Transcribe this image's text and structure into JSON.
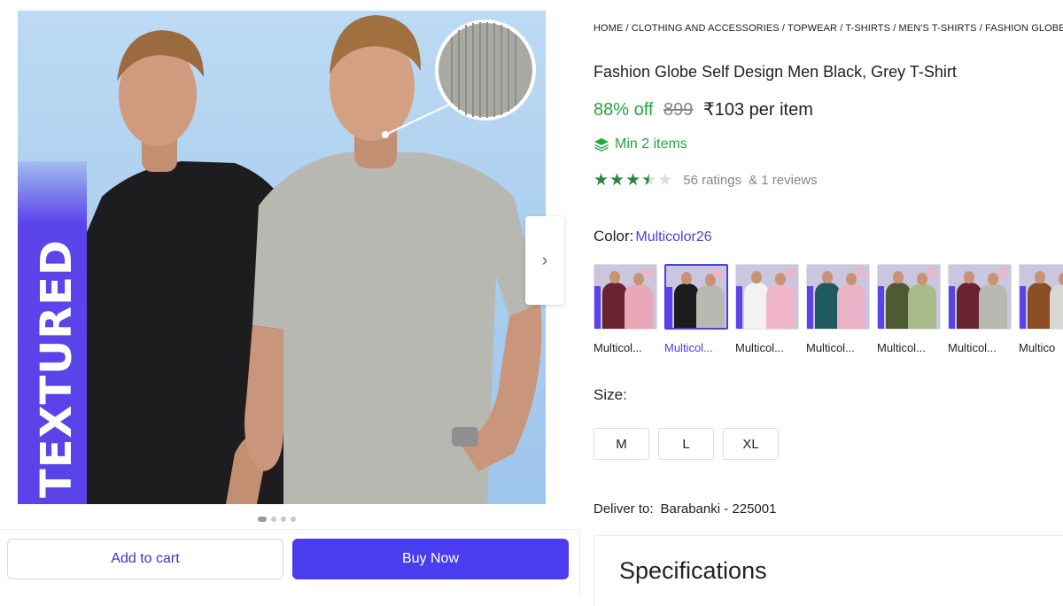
{
  "gallery": {
    "overlay_text": "TEXTURED",
    "next_icon": "chevron-right-icon",
    "next_glyph": "›",
    "dots": [
      true,
      false,
      false,
      false
    ]
  },
  "actions": {
    "add_to_cart": "Add to cart",
    "buy_now": "Buy Now"
  },
  "breadcrumb": "HOME / CLOTHING AND ACCESSORIES / TOPWEAR / T-SHIRTS / MEN'S T-SHIRTS / FASHION GLOBE",
  "product": {
    "title": "Fashion Globe Self Design Men Black, Grey T-Shirt",
    "discount": "88% off",
    "mrp": "899",
    "price": "₹103 per item",
    "min_items": "Min 2 items",
    "rating_value": 3.5,
    "ratings": "56 ratings",
    "reviews": "& 1 reviews"
  },
  "color": {
    "label": "Color:",
    "value": "Multicolor26",
    "swatches": [
      {
        "label": "Multicol...",
        "c1": "#6b2330",
        "c2": "#e8a8b8"
      },
      {
        "label": "Multicol...",
        "c1": "#1c1c1c",
        "c2": "#b9b9b3"
      },
      {
        "label": "Multicol...",
        "c1": "#f2f2f0",
        "c2": "#f0b6c8"
      },
      {
        "label": "Multicol...",
        "c1": "#1f5b5e",
        "c2": "#eab4c8"
      },
      {
        "label": "Multicol...",
        "c1": "#4f5a33",
        "c2": "#a8b98a"
      },
      {
        "label": "Multicol...",
        "c1": "#6b2330",
        "c2": "#b9b9b3"
      },
      {
        "label": "Multico",
        "c1": "#8a4e24",
        "c2": "#d8d8d4"
      }
    ],
    "selected_index": 1
  },
  "size": {
    "label": "Size:",
    "options": [
      "M",
      "L",
      "XL"
    ]
  },
  "delivery": {
    "label": "Deliver to:",
    "location": "Barabanki - 225001"
  },
  "specs": {
    "title": "Specifications"
  },
  "colors": {
    "accent": "#4a3df0",
    "green": "#26a541",
    "star_green": "#1f8b3a"
  }
}
